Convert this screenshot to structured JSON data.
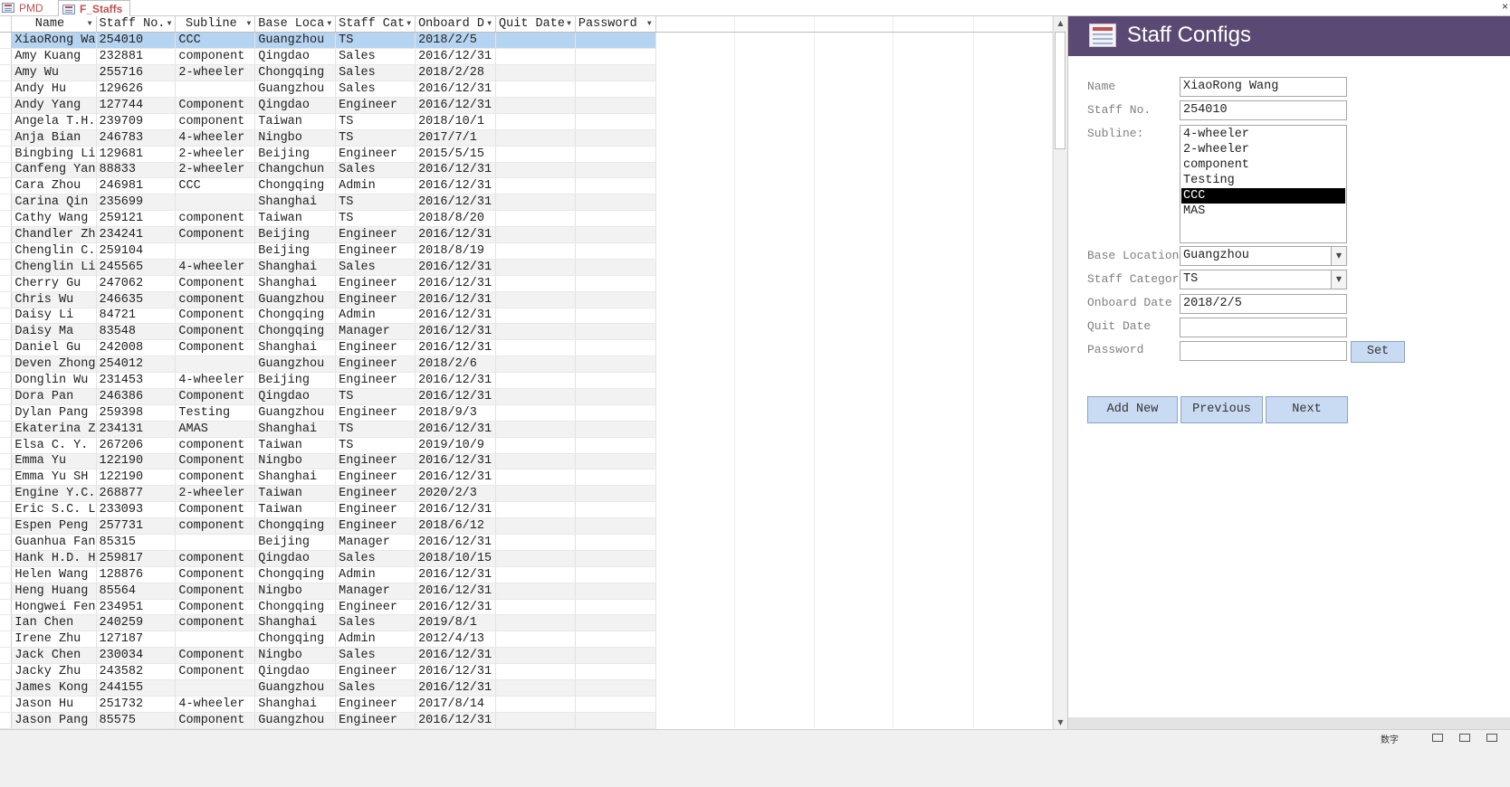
{
  "tabs": [
    {
      "label": "PMD"
    },
    {
      "label": "F_Staffs"
    }
  ],
  "close_glyph": "×",
  "grid": {
    "columns": [
      "Name",
      "Staff No.",
      "Subline",
      "Base Loca",
      "Staff Cat",
      "Onboard D",
      "Quit Date",
      "Password"
    ],
    "rows": [
      [
        "XiaoRong Wa",
        "254010",
        "CCC",
        "Guangzhou",
        "TS",
        "2018/2/5",
        "",
        ""
      ],
      [
        "Amy Kuang",
        "232881",
        "component",
        "Qingdao",
        "Sales",
        "2016/12/31",
        "",
        ""
      ],
      [
        "Amy Wu",
        "255716",
        "2-wheeler",
        "Chongqing",
        "Sales",
        "2018/2/28",
        "",
        ""
      ],
      [
        "Andy Hu",
        "129626",
        "",
        "Guangzhou",
        "Sales",
        "2016/12/31",
        "",
        ""
      ],
      [
        "Andy Yang",
        "127744",
        "Component",
        "Qingdao",
        "Engineer",
        "2016/12/31",
        "",
        ""
      ],
      [
        "Angela T.H.",
        "239709",
        "component",
        "Taiwan",
        "TS",
        "2018/10/1",
        "",
        ""
      ],
      [
        "Anja Bian",
        "246783",
        "4-wheeler",
        "Ningbo",
        "TS",
        "2017/7/1",
        "",
        ""
      ],
      [
        "Bingbing Li",
        "129681",
        "2-wheeler",
        "Beijing",
        "Engineer",
        "2015/5/15",
        "",
        ""
      ],
      [
        "Canfeng Yan",
        "88833",
        "2-wheeler",
        "Changchun",
        "Sales",
        "2016/12/31",
        "",
        ""
      ],
      [
        "Cara Zhou",
        "246981",
        "CCC",
        "Chongqing",
        "Admin",
        "2016/12/31",
        "",
        ""
      ],
      [
        "Carina Qin",
        "235699",
        "",
        "Shanghai",
        "TS",
        "2016/12/31",
        "",
        ""
      ],
      [
        "Cathy Wang",
        "259121",
        "component",
        "Taiwan",
        "TS",
        "2018/8/20",
        "",
        ""
      ],
      [
        "Chandler Zh",
        "234241",
        "Component",
        "Beijing",
        "Engineer",
        "2016/12/31",
        "",
        ""
      ],
      [
        "Chenglin C.",
        "259104",
        "",
        "Beijing",
        "Engineer",
        "2018/8/19",
        "",
        ""
      ],
      [
        "Chenglin Li",
        "245565",
        "4-wheeler",
        "Shanghai",
        "Sales",
        "2016/12/31",
        "",
        ""
      ],
      [
        "Cherry Gu",
        "247062",
        "Component",
        "Shanghai",
        "Engineer",
        "2016/12/31",
        "",
        ""
      ],
      [
        "Chris Wu",
        "246635",
        "component",
        "Guangzhou",
        "Engineer",
        "2016/12/31",
        "",
        ""
      ],
      [
        "Daisy Li",
        "84721",
        "Component",
        "Chongqing",
        "Admin",
        "2016/12/31",
        "",
        ""
      ],
      [
        "Daisy Ma",
        "83548",
        "Component",
        "Chongqing",
        "Manager",
        "2016/12/31",
        "",
        ""
      ],
      [
        "Daniel Gu",
        "242008",
        "Component",
        "Shanghai",
        "Engineer",
        "2016/12/31",
        "",
        ""
      ],
      [
        "Deven Zhong",
        "254012",
        "",
        "Guangzhou",
        "Engineer",
        "2018/2/6",
        "",
        ""
      ],
      [
        "Donglin Wu",
        "231453",
        "4-wheeler",
        "Beijing",
        "Engineer",
        "2016/12/31",
        "",
        ""
      ],
      [
        "Dora Pan",
        "246386",
        "Component",
        "Qingdao",
        "TS",
        "2016/12/31",
        "",
        ""
      ],
      [
        "Dylan Pang",
        "259398",
        "Testing",
        "Guangzhou",
        "Engineer",
        "2018/9/3",
        "",
        ""
      ],
      [
        "Ekaterina Z",
        "234131",
        "AMAS",
        "Shanghai",
        "TS",
        "2016/12/31",
        "",
        ""
      ],
      [
        "Elsa C. Y.",
        "267206",
        "component",
        "Taiwan",
        "TS",
        "2019/10/9",
        "",
        ""
      ],
      [
        "Emma Yu",
        "122190",
        "Component",
        "Ningbo",
        "Engineer",
        "2016/12/31",
        "",
        ""
      ],
      [
        "Emma Yu SH",
        "122190",
        "component",
        "Shanghai",
        "Engineer",
        "2016/12/31",
        "",
        ""
      ],
      [
        "Engine Y.C.",
        "268877",
        "2-wheeler",
        "Taiwan",
        "Engineer",
        "2020/2/3",
        "",
        ""
      ],
      [
        "Eric S.C. L",
        "233093",
        "Component",
        "Taiwan",
        "Engineer",
        "2016/12/31",
        "",
        ""
      ],
      [
        "Espen Peng",
        "257731",
        "component",
        "Chongqing",
        "Engineer",
        "2018/6/12",
        "",
        ""
      ],
      [
        "Guanhua Fan",
        "85315",
        "",
        "Beijing",
        "Manager",
        "2016/12/31",
        "",
        ""
      ],
      [
        "Hank H.D. H",
        "259817",
        "component",
        "Qingdao",
        "Sales",
        "2018/10/15",
        "",
        ""
      ],
      [
        "Helen Wang",
        "128876",
        "Component",
        "Chongqing",
        "Admin",
        "2016/12/31",
        "",
        ""
      ],
      [
        "Heng Huang",
        "85564",
        "Component",
        "Ningbo",
        "Manager",
        "2016/12/31",
        "",
        ""
      ],
      [
        "Hongwei Fen",
        "234951",
        "Component",
        "Chongqing",
        "Engineer",
        "2016/12/31",
        "",
        ""
      ],
      [
        "Ian Chen",
        "240259",
        "component",
        "Shanghai",
        "Sales",
        "2019/8/1",
        "",
        ""
      ],
      [
        "Irene Zhu",
        "127187",
        "",
        "Chongqing",
        "Admin",
        "2012/4/13",
        "",
        ""
      ],
      [
        "Jack Chen",
        "230034",
        "Component",
        "Ningbo",
        "Sales",
        "2016/12/31",
        "",
        ""
      ],
      [
        "Jacky Zhu",
        "243582",
        "Component",
        "Qingdao",
        "Engineer",
        "2016/12/31",
        "",
        ""
      ],
      [
        "James Kong",
        "244155",
        "",
        "Guangzhou",
        "Sales",
        "2016/12/31",
        "",
        ""
      ],
      [
        "Jason Hu",
        "251732",
        "4-wheeler",
        "Shanghai",
        "Engineer",
        "2017/8/14",
        "",
        ""
      ],
      [
        "Jason Pang",
        "85575",
        "Component",
        "Guangzhou",
        "Engineer",
        "2016/12/31",
        "",
        ""
      ]
    ]
  },
  "form": {
    "title": "Staff Configs",
    "name_label": "Name",
    "name_value": "XiaoRong Wang",
    "staffno_label": "Staff No.",
    "staffno_value": "254010",
    "subline_label": "Subline:",
    "subline_options": [
      "4-wheeler",
      "2-wheeler",
      "component",
      "Testing",
      "CCC",
      "MAS"
    ],
    "subline_selected": "CCC",
    "base_label": "Base Location",
    "base_value": "Guangzhou",
    "category_label": "Staff Categor",
    "category_value": "TS",
    "onboard_label": "Onboard Date",
    "onboard_value": "2018/2/5",
    "quit_label": "Quit Date",
    "quit_value": "",
    "password_label": "Password",
    "password_value": "",
    "set_label": "Set",
    "add_new_label": "Add New",
    "previous_label": "Previous",
    "next_label": "Next"
  },
  "status": {
    "mode_text": "数字"
  },
  "colors": {
    "header_bg": "#5a4a73",
    "selected_row": "#b5d4f1",
    "button_bg": "#c9dbf2",
    "tab_text": "#c0504d"
  }
}
